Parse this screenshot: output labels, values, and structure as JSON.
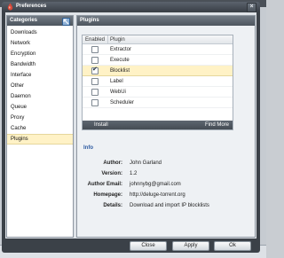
{
  "window": {
    "title": "Preferences",
    "close_glyph": "×",
    "logo_icon": "deluge-logo-icon",
    "close_icon": "close-icon"
  },
  "categories": {
    "header": "Categories",
    "collapse_icon": "collapse-icon",
    "items": [
      {
        "label": "Downloads"
      },
      {
        "label": "Network"
      },
      {
        "label": "Encryption"
      },
      {
        "label": "Bandwidth"
      },
      {
        "label": "Interface"
      },
      {
        "label": "Other"
      },
      {
        "label": "Daemon"
      },
      {
        "label": "Queue"
      },
      {
        "label": "Proxy"
      },
      {
        "label": "Cache"
      },
      {
        "label": "Plugins"
      }
    ],
    "selected": "Plugins"
  },
  "plugins": {
    "header": "Plugins",
    "table": {
      "col_enabled": "Enabled",
      "col_plugin": "Plugin",
      "rows": [
        {
          "name": "Extractor",
          "enabled": false
        },
        {
          "name": "Execute",
          "enabled": false
        },
        {
          "name": "Blocklist",
          "enabled": true
        },
        {
          "name": "Label",
          "enabled": false
        },
        {
          "name": "WebUi",
          "enabled": false
        },
        {
          "name": "Scheduler",
          "enabled": false
        }
      ],
      "selected_row": "Blocklist",
      "check_glyph": "✔"
    },
    "footer": {
      "install_label": "Install",
      "find_more_label": "Find More"
    },
    "info": {
      "title": "Info",
      "author_label": "Author:",
      "author": "John Garland",
      "version_label": "Version:",
      "version": "1.2",
      "email_label": "Author Email:",
      "email": "johnnybg@gmail.com",
      "homepage_label": "Homepage:",
      "homepage": "http://deluge-torrent.org",
      "details_label": "Details:",
      "details": "Download and import IP blocklists"
    }
  },
  "buttons": {
    "close": "Close",
    "apply": "Apply",
    "ok": "Ok"
  },
  "colors": {
    "selection": "#fff2c6",
    "header_dark": "#4d555e",
    "info_blue": "#2a58a0"
  }
}
